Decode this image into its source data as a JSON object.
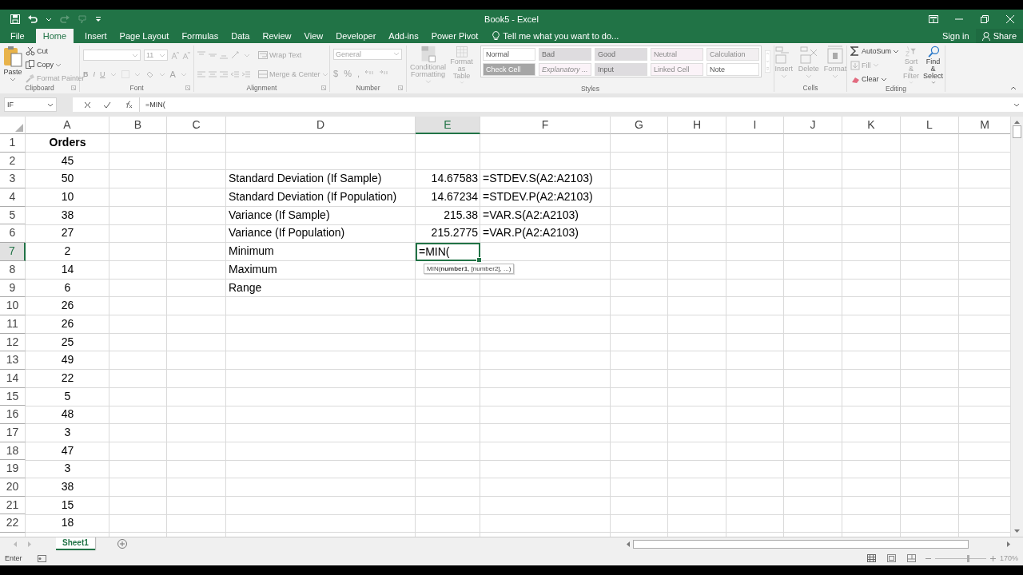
{
  "window": {
    "title": "Book5 - Excel"
  },
  "ribbon_tabs": [
    {
      "label": "File",
      "selected": false
    },
    {
      "label": "Home",
      "selected": true
    },
    {
      "label": "Insert",
      "selected": false
    },
    {
      "label": "Page Layout",
      "selected": false
    },
    {
      "label": "Formulas",
      "selected": false
    },
    {
      "label": "Data",
      "selected": false
    },
    {
      "label": "Review",
      "selected": false
    },
    {
      "label": "View",
      "selected": false
    },
    {
      "label": "Developer",
      "selected": false
    },
    {
      "label": "Add-ins",
      "selected": false
    },
    {
      "label": "Power Pivot",
      "selected": false
    }
  ],
  "tell_me": "Tell me what you want to do...",
  "account": {
    "sign_in": "Sign in",
    "share": "Share"
  },
  "ribbon": {
    "groups": [
      {
        "kind": "clipboard",
        "label": "Clipboard",
        "paste": {
          "label": "Paste",
          "disabled": false
        },
        "commands": [
          {
            "label": "Cut",
            "disabled": false
          },
          {
            "label": "Copy",
            "disabled": false
          },
          {
            "label": "Format Painter",
            "disabled": true
          }
        ]
      },
      {
        "kind": "font",
        "label": "Font",
        "font_size": "11",
        "styles": [
          "B",
          "I",
          "U"
        ],
        "font_color": "A"
      },
      {
        "kind": "alignment",
        "label": "Alignment",
        "commands": [
          {
            "label": "Wrap Text",
            "disabled": true
          },
          {
            "label": "Merge & Center",
            "disabled": true
          }
        ]
      },
      {
        "kind": "number",
        "label": "Number",
        "format": "General",
        "symbols": [
          "$",
          "%",
          ","
        ]
      },
      {
        "kind": "styles",
        "label": "Styles",
        "commands": [
          {
            "label": "Conditional Formatting",
            "disabled": true
          },
          {
            "label": "Format as Table",
            "disabled": true
          }
        ],
        "gallery": [
          {
            "label": "Normal",
            "color": "#ffffff",
            "italic": false
          },
          {
            "label": "Bad",
            "color": "#dedcdf",
            "italic": false
          },
          {
            "label": "Good",
            "color": "#dedcdf",
            "italic": false
          },
          {
            "label": "Neutral",
            "color": "#f6eef3",
            "italic": false
          },
          {
            "label": "Calculation",
            "color": "#f2eff1",
            "italic": false
          },
          {
            "label": "Check Cell",
            "color": "#a6a6a6",
            "italic": false
          },
          {
            "label": "Explanatory ...",
            "color": "#fbf3f8",
            "italic": true
          },
          {
            "label": "Input",
            "color": "#dedcdf",
            "italic": false
          },
          {
            "label": "Linked Cell",
            "color": "#fbf3f8",
            "italic": false
          },
          {
            "label": "Note",
            "color": "#ffffff",
            "italic": false
          }
        ]
      },
      {
        "kind": "cells",
        "label": "Cells",
        "commands": [
          {
            "label": "Insert",
            "disabled": true
          },
          {
            "label": "Delete",
            "disabled": true
          },
          {
            "label": "Format",
            "disabled": true
          }
        ]
      },
      {
        "kind": "editing",
        "label": "Editing",
        "commands": [
          {
            "label": "AutoSum",
            "disabled": false
          },
          {
            "label": "Fill",
            "disabled": true
          },
          {
            "label": "Clear",
            "disabled": false
          }
        ],
        "large": [
          {
            "label": "Sort & Filter",
            "disabled": true
          },
          {
            "label": "Find & Select",
            "disabled": false
          }
        ]
      }
    ]
  },
  "formula_bar": {
    "name_box": "IF",
    "formula": "=MIN("
  },
  "columns": [
    {
      "label": "A",
      "selected": false
    },
    {
      "label": "B",
      "selected": false
    },
    {
      "label": "C",
      "selected": false
    },
    {
      "label": "D",
      "selected": false
    },
    {
      "label": "E",
      "selected": true
    },
    {
      "label": "F",
      "selected": false
    },
    {
      "label": "G",
      "selected": false
    },
    {
      "label": "H",
      "selected": false
    },
    {
      "label": "I",
      "selected": false
    },
    {
      "label": "J",
      "selected": false
    },
    {
      "label": "K",
      "selected": false
    },
    {
      "label": "L",
      "selected": false
    },
    {
      "label": "M",
      "selected": false
    }
  ],
  "rows": [
    {
      "label": "1",
      "selected": false,
      "cells": {
        "A": "Orders"
      }
    },
    {
      "label": "2",
      "selected": false,
      "cells": {
        "A": "45"
      }
    },
    {
      "label": "3",
      "selected": false,
      "cells": {
        "A": "50",
        "D": "Standard Deviation (If Sample)",
        "E": "14.67583",
        "F": "=STDEV.S(A2:A2103)"
      }
    },
    {
      "label": "4",
      "selected": false,
      "cells": {
        "A": "10",
        "D": "Standard Deviation (If Population)",
        "E": "14.67234",
        "F": "=STDEV.P(A2:A2103)"
      }
    },
    {
      "label": "5",
      "selected": false,
      "cells": {
        "A": "38",
        "D": "Variance (If Sample)",
        "E": "215.38",
        "F": "=VAR.S(A2:A2103)"
      }
    },
    {
      "label": "6",
      "selected": false,
      "cells": {
        "A": "27",
        "D": "Variance (If Population)",
        "E": "215.2775",
        "F": "=VAR.P(A2:A2103)"
      }
    },
    {
      "label": "7",
      "selected": true,
      "cells": {
        "A": "2",
        "D": "Minimum"
      },
      "editor": {
        "value": "=MIN(",
        "tooltip": "MIN(**number1**, [number2], ...)"
      }
    },
    {
      "label": "8",
      "selected": false,
      "cells": {
        "A": "14",
        "D": "Maximum"
      }
    },
    {
      "label": "9",
      "selected": false,
      "cells": {
        "A": "6",
        "D": "Range"
      }
    },
    {
      "label": "10",
      "selected": false,
      "cells": {
        "A": "26"
      }
    },
    {
      "label": "11",
      "selected": false,
      "cells": {
        "A": "26"
      }
    },
    {
      "label": "12",
      "selected": false,
      "cells": {
        "A": "25"
      }
    },
    {
      "label": "13",
      "selected": false,
      "cells": {
        "A": "49"
      }
    },
    {
      "label": "14",
      "selected": false,
      "cells": {
        "A": "22"
      }
    },
    {
      "label": "15",
      "selected": false,
      "cells": {
        "A": "5"
      }
    },
    {
      "label": "16",
      "selected": false,
      "cells": {
        "A": "48"
      }
    },
    {
      "label": "17",
      "selected": false,
      "cells": {
        "A": "3"
      }
    },
    {
      "label": "18",
      "selected": false,
      "cells": {
        "A": "47"
      }
    },
    {
      "label": "19",
      "selected": false,
      "cells": {
        "A": "3"
      }
    },
    {
      "label": "20",
      "selected": false,
      "cells": {
        "A": "38"
      }
    },
    {
      "label": "21",
      "selected": false,
      "cells": {
        "A": "15"
      }
    },
    {
      "label": "22",
      "selected": false,
      "cells": {
        "A": "18"
      }
    }
  ],
  "sheet_tabs": [
    {
      "label": "Sheet1",
      "selected": true
    }
  ],
  "status_bar": {
    "mode": "Enter",
    "zoom": {
      "level": 0.62,
      "reading": "170%"
    }
  }
}
